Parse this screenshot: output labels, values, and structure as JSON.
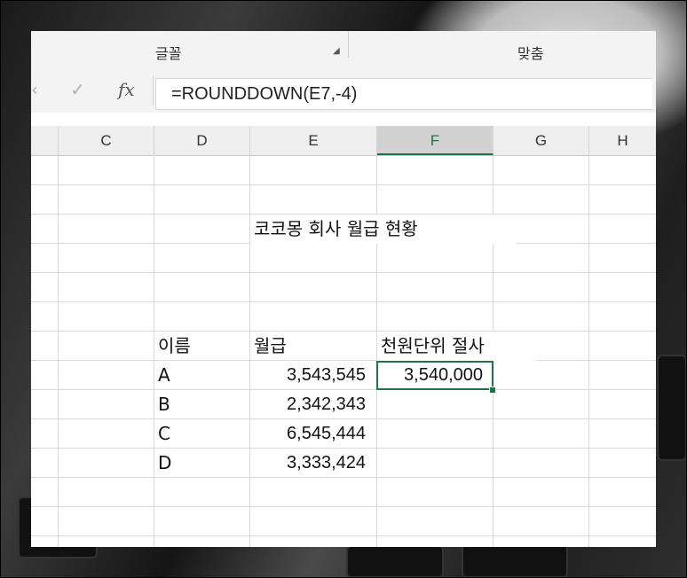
{
  "ribbon": {
    "group_font": "글꼴",
    "group_align": "맞춤"
  },
  "formula_bar": {
    "cancel_icon": "x-icon",
    "enter_icon": "check-icon",
    "fx_label": "fx",
    "formula": "=ROUNDDOWN(E7,-4)"
  },
  "columns": [
    "C",
    "D",
    "E",
    "F",
    "G",
    "H"
  ],
  "active_column": "F",
  "title": "코코몽 회사 월급 현황",
  "headers": {
    "name": "이름",
    "salary": "월급",
    "rounded": "천원단위 절사"
  },
  "rows": [
    {
      "name": "A",
      "salary": "3,543,545",
      "rounded": "3,540,000"
    },
    {
      "name": "B",
      "salary": "2,342,343",
      "rounded": ""
    },
    {
      "name": "C",
      "salary": "6,545,444",
      "rounded": ""
    },
    {
      "name": "D",
      "salary": "3,333,424",
      "rounded": ""
    }
  ],
  "colors": {
    "accent": "#217346"
  }
}
